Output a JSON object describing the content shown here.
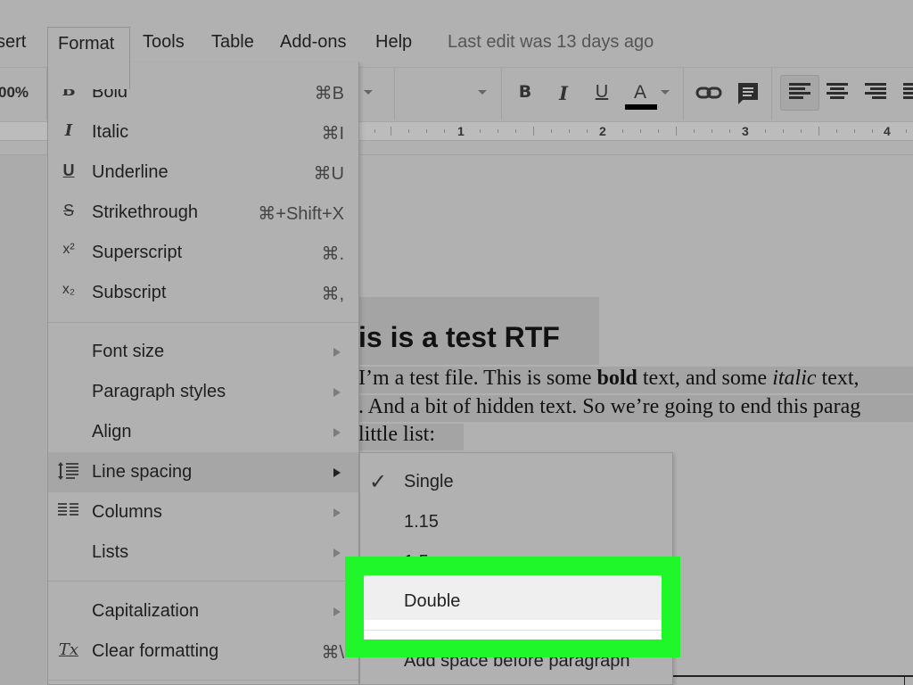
{
  "menubar": {
    "items": [
      {
        "label": "sert"
      },
      {
        "label": "Format"
      },
      {
        "label": "Tools"
      },
      {
        "label": "Table"
      },
      {
        "label": "Add-ons"
      },
      {
        "label": "Help"
      }
    ],
    "last_edit": "Last edit was 13 days ago"
  },
  "toolbar": {
    "zoom": "00%",
    "bold_icon": "B",
    "italic_icon": "I",
    "underline_icon": "U",
    "text_color_icon": "A",
    "text_color": "#000000",
    "link_icon": "link-icon",
    "comment_icon": "comment-icon"
  },
  "ruler": {
    "labels": [
      "1",
      "2",
      "3",
      "4"
    ]
  },
  "document": {
    "title": "is is a test RTF",
    "lines": [
      {
        "pre": "I’m a test file. This is some ",
        "bold": "bold",
        "mid": " text, and some ",
        "italic": "italic",
        "post": " text,"
      },
      {
        "text": ". And a bit of hidden text. So we’re going to end this parag"
      },
      {
        "text": " little list:"
      }
    ]
  },
  "format_menu": {
    "items": [
      {
        "icon": "B",
        "label": "Bold",
        "shortcut": "⌘B"
      },
      {
        "icon": "I",
        "label": "Italic",
        "shortcut": "⌘I"
      },
      {
        "icon": "U",
        "label": "Underline",
        "shortcut": "⌘U"
      },
      {
        "icon": "S",
        "label": "Strikethrough",
        "shortcut": "⌘+Shift+X"
      },
      {
        "icon": "x²",
        "label": "Superscript",
        "shortcut": "⌘."
      },
      {
        "icon": "x₂",
        "label": "Subscript",
        "shortcut": "⌘,"
      },
      {
        "label": "Font size"
      },
      {
        "label": "Paragraph styles"
      },
      {
        "label": "Align"
      },
      {
        "label": "Line spacing"
      },
      {
        "label": "Columns"
      },
      {
        "label": "Lists"
      },
      {
        "label": "Capitalization"
      },
      {
        "icon": "Tx",
        "label": "Clear formatting",
        "shortcut": "⌘\\"
      }
    ]
  },
  "line_spacing_submenu": {
    "items": [
      {
        "label": "Single",
        "checked": true
      },
      {
        "label": "1.15"
      },
      {
        "label": "1.5"
      },
      {
        "label": "Double",
        "highlighted": true
      },
      {
        "label": "Add space before paragraph"
      }
    ]
  },
  "highlight_color": "#1ff72a"
}
